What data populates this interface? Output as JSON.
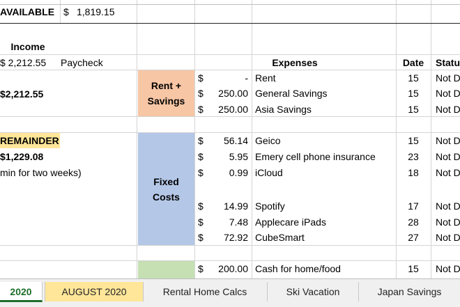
{
  "available": {
    "label": "AVAILABLE",
    "currency": "$",
    "amount": "1,819.15"
  },
  "income": {
    "header": "Income",
    "row_amount": "$  2,212.55",
    "row_label": "Paycheck",
    "total": "$2,212.55",
    "remainder_label": "REMAINDER",
    "remainder_amount": "$1,229.08",
    "remainder_note": "min for two weeks)"
  },
  "expenses": {
    "header": "Expenses",
    "date_header": "Date",
    "status_header": "Statu",
    "groups": {
      "rent_savings": {
        "line1": "Rent +",
        "line2": "Savings"
      },
      "fixed_costs": {
        "line1": "Fixed",
        "line2": "Costs"
      }
    },
    "rows": [
      {
        "currency": "$",
        "amount": "-",
        "name": "Rent",
        "date": "15",
        "status": "Not D"
      },
      {
        "currency": "$",
        "amount": "250.00",
        "name": "General Savings",
        "date": "15",
        "status": "Not D"
      },
      {
        "currency": "$",
        "amount": "250.00",
        "name": "Asia Savings",
        "date": "15",
        "status": "Not D"
      },
      {
        "currency": "$",
        "amount": "56.14",
        "name": "Geico",
        "date": "15",
        "status": "Not D"
      },
      {
        "currency": "$",
        "amount": "5.95",
        "name": "Emery cell phone insurance",
        "date": "23",
        "status": "Not D"
      },
      {
        "currency": "$",
        "amount": "0.99",
        "name": "iCloud",
        "date": "18",
        "status": "Not D"
      },
      {
        "currency": "$",
        "amount": "14.99",
        "name": "Spotify",
        "date": "17",
        "status": "Not D"
      },
      {
        "currency": "$",
        "amount": "7.48",
        "name": "Applecare iPads",
        "date": "28",
        "status": "Not D"
      },
      {
        "currency": "$",
        "amount": "72.92",
        "name": "CubeSmart",
        "date": "27",
        "status": "Not D"
      },
      {
        "currency": "$",
        "amount": "200.00",
        "name": "Cash for home/food",
        "date": "15",
        "status": "Not D"
      }
    ]
  },
  "tabs": [
    {
      "label": "2020"
    },
    {
      "label": "AUGUST 2020"
    },
    {
      "label": "Rental Home Calcs"
    },
    {
      "label": "Ski Vacation"
    },
    {
      "label": "Japan Savings"
    }
  ],
  "colors": {
    "rent_savings": "#f7c6a5",
    "fixed_costs": "#b4c7e7",
    "remainder": "#ffe699",
    "active_tab": "#1e6e2b"
  }
}
